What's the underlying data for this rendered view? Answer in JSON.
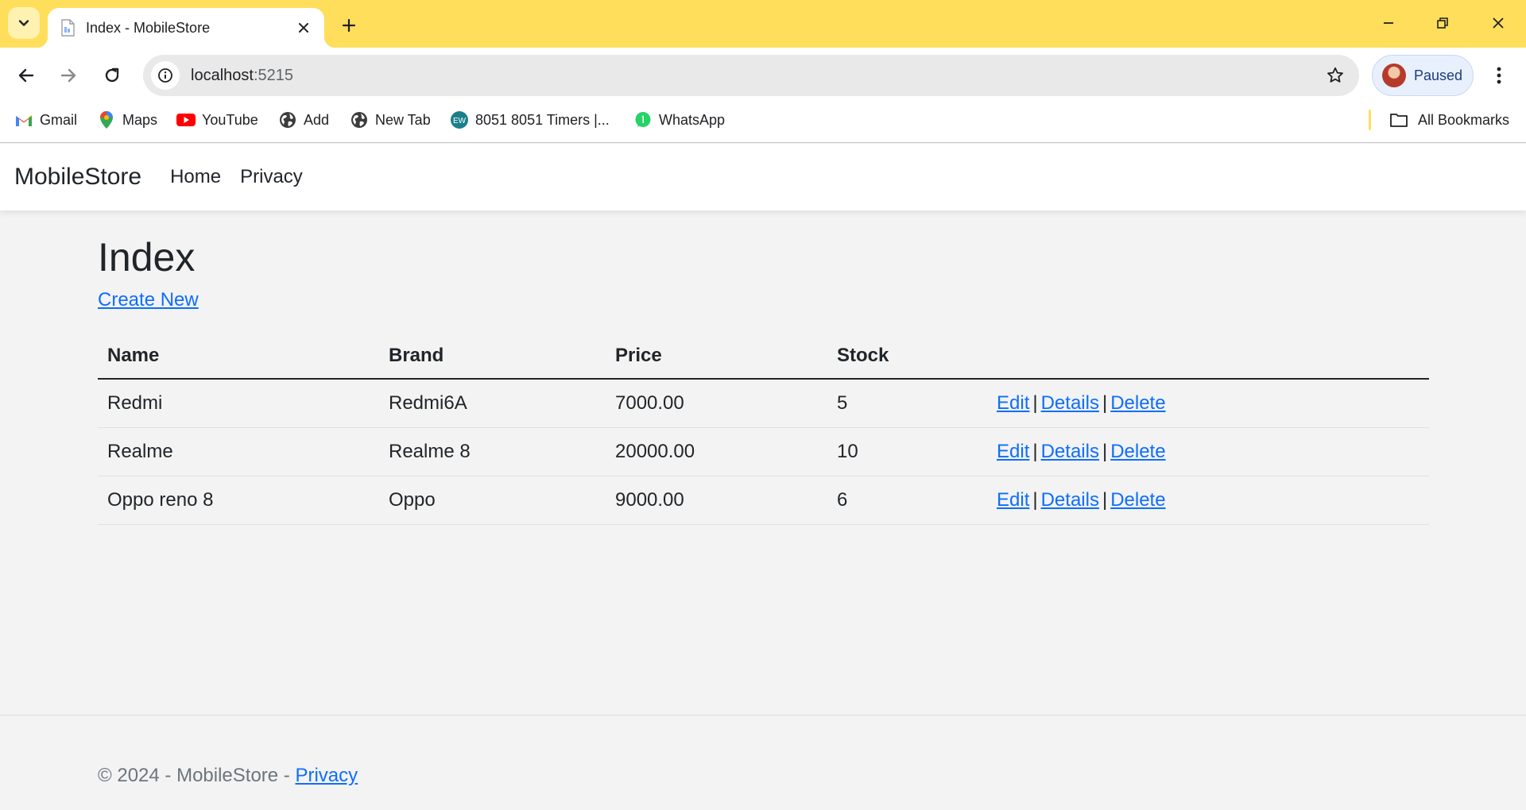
{
  "browser": {
    "tab_title": "Index - MobileStore",
    "url_host": "localhost",
    "url_port": ":5215",
    "profile_label": "Paused",
    "bookmarks": [
      {
        "label": "Gmail",
        "icon": "gmail-icon"
      },
      {
        "label": "Maps",
        "icon": "maps-icon"
      },
      {
        "label": "YouTube",
        "icon": "youtube-icon"
      },
      {
        "label": "Add",
        "icon": "globe-icon"
      },
      {
        "label": "New Tab",
        "icon": "globe-icon"
      },
      {
        "label": "8051 8051 Timers |...",
        "icon": "ew-icon",
        "icon_text": "EW"
      },
      {
        "label": "WhatsApp",
        "icon": "whatsapp-icon"
      }
    ],
    "all_bookmarks_label": "All Bookmarks",
    "colors": {
      "frame": "#ffde5b",
      "link": "#0d6efd"
    }
  },
  "app": {
    "brand": "MobileStore",
    "nav": [
      "Home",
      "Privacy"
    ]
  },
  "page": {
    "title": "Index",
    "create_link": "Create New",
    "table": {
      "columns": [
        "Name",
        "Brand",
        "Price",
        "Stock"
      ],
      "rows": [
        {
          "name": "Redmi",
          "brand": "Redmi6A",
          "price": "7000.00",
          "stock": "5"
        },
        {
          "name": "Realme",
          "brand": "Realme 8",
          "price": "20000.00",
          "stock": "10"
        },
        {
          "name": "Oppo reno 8",
          "brand": "Oppo",
          "price": "9000.00",
          "stock": "6"
        }
      ],
      "actions": {
        "edit": "Edit",
        "details": "Details",
        "delete": "Delete",
        "separator": "|"
      }
    }
  },
  "footer": {
    "text": "© 2024 - MobileStore - ",
    "link": "Privacy"
  }
}
